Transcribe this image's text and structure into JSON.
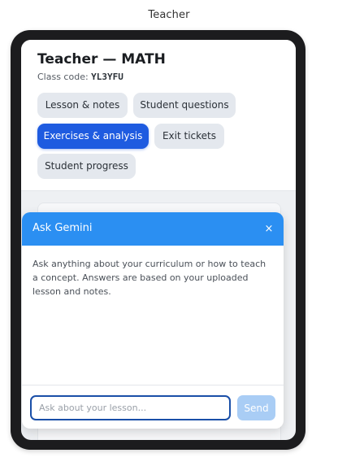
{
  "page": {
    "label": "Teacher"
  },
  "header": {
    "title": "Teacher — MATH",
    "class_code_label": "Class code:",
    "class_code": "YL3YFU"
  },
  "tabs": [
    {
      "label": "Lesson & notes",
      "active": false
    },
    {
      "label": "Student questions",
      "active": false
    },
    {
      "label": "Exercises & analysis",
      "active": true
    },
    {
      "label": "Exit tickets",
      "active": false
    },
    {
      "label": "Student progress",
      "active": false
    }
  ],
  "colors": {
    "active_tab": "#1e5be0",
    "modal_header": "#2b8ff2",
    "send_disabled": "#a9cdf5"
  },
  "gemini": {
    "title": "Ask Gemini",
    "close_icon": "×",
    "description": "Ask anything about your curriculum or how to teach a concept. Answers are based on your uploaded lesson and notes.",
    "input_value": "",
    "input_placeholder": "Ask about your lesson...",
    "send_label": "Send"
  }
}
